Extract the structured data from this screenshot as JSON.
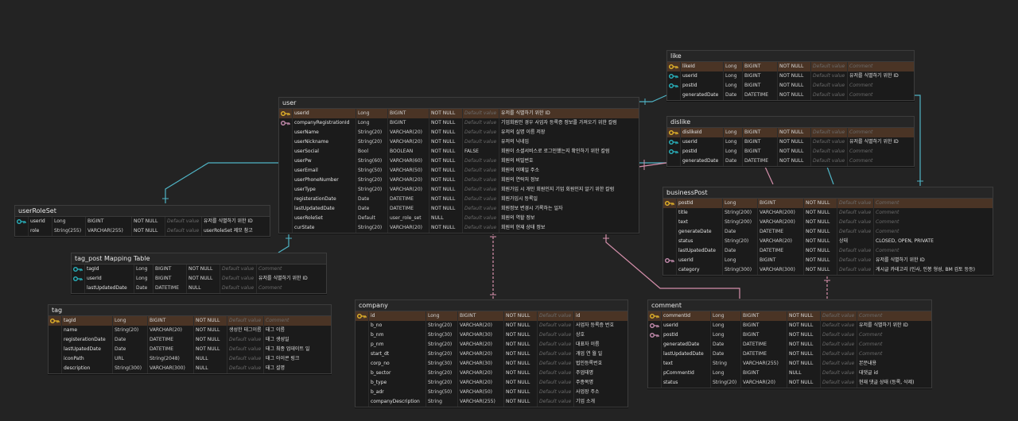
{
  "colors": {
    "background": "#232323",
    "pk_row": "#4a3425",
    "key_gold": "#e5b52a",
    "key_teal": "#29b6c1",
    "key_pink": "#c98fb2",
    "wire_teal": "#4fb3c4",
    "wire_pink": "#d58fab"
  },
  "tables": [
    {
      "id": "user",
      "title": "user",
      "rows": [
        {
          "key": "pk",
          "name": "userId",
          "type": "Long",
          "db": "BIGINT",
          "null": "NOT NULL",
          "default": "Default value",
          "comment": "유저를 식별하기 위한 ID"
        },
        {
          "key": "fk-pink",
          "name": "companyRegistrationId",
          "type": "Long",
          "db": "BIGINT",
          "null": "NOT NULL",
          "default": "Default value",
          "comment": "기업회원인 경우 사업자 등록증 정보를 가져오기 위한 칼럼"
        },
        {
          "key": "",
          "name": "userName",
          "type": "String(20)",
          "db": "VARCHAR(20)",
          "null": "NOT NULL",
          "default": "Default value",
          "comment": "유저의 실명 이름 저장"
        },
        {
          "key": "",
          "name": "userNickname",
          "type": "String(20)",
          "db": "VARCHAR(20)",
          "null": "NOT NULL",
          "default": "Default value",
          "comment": "유저의 닉네임"
        },
        {
          "key": "",
          "name": "userSocial",
          "type": "Bool",
          "db": "BOOLEAN",
          "null": "NOT NULL",
          "default": "FALSE",
          "comment": "회원이 소셜서비스로 로그인했는지 확인하기 위한 칼럼"
        },
        {
          "key": "",
          "name": "userPw",
          "type": "String(60)",
          "db": "VARCHAR(60)",
          "null": "NOT NULL",
          "default": "Default value",
          "comment": "회원의 비밀번호"
        },
        {
          "key": "",
          "name": "userEmail",
          "type": "String(50)",
          "db": "VARCHAR(50)",
          "null": "NOT NULL",
          "default": "Default value",
          "comment": "회원의 이메일 주소"
        },
        {
          "key": "",
          "name": "userPhoneNumber",
          "type": "String(20)",
          "db": "VARCHAR(20)",
          "null": "NOT NULL",
          "default": "Default value",
          "comment": "회원의 연락처 정보"
        },
        {
          "key": "",
          "name": "userType",
          "type": "String(20)",
          "db": "VARCHAR(20)",
          "null": "NOT NULL",
          "default": "Default value",
          "comment": "회원가입 시 개인 회원인지 기업 회원인지 알기 위한 칼럼"
        },
        {
          "key": "",
          "name": "registerationDate",
          "type": "Date",
          "db": "DATETIME",
          "null": "NOT NULL",
          "default": "Default value",
          "comment": "회원가입시 등록일"
        },
        {
          "key": "",
          "name": "lastUpdatedDate",
          "type": "Date",
          "db": "DATETIME",
          "null": "NOT NULL",
          "default": "Default value",
          "comment": "회원정보 변경시 기록하는 일자"
        },
        {
          "key": "",
          "name": "userRoleSet",
          "type": "Default",
          "db": "user_role_set",
          "null": "NULL",
          "default": "Default value",
          "comment": "회원의 역할 정보"
        },
        {
          "key": "",
          "name": "curState",
          "type": "String(20)",
          "db": "VARCHAR(20)",
          "null": "NOT NULL",
          "default": "Default value",
          "comment": "회원의 현재 상태 정보"
        }
      ]
    },
    {
      "id": "like",
      "title": "like",
      "rows": [
        {
          "key": "pk",
          "name": "likeId",
          "type": "Long",
          "db": "BIGINT",
          "null": "NOT NULL",
          "default": "Default value",
          "comment": "Comment"
        },
        {
          "key": "fk-teal",
          "name": "userId",
          "type": "Long",
          "db": "BIGINT",
          "null": "NOT NULL",
          "default": "Default value",
          "comment": "유저를 식별하기 위한 ID"
        },
        {
          "key": "fk-teal",
          "name": "postId",
          "type": "Long",
          "db": "BIGINT",
          "null": "NOT NULL",
          "default": "Default value",
          "comment": "Comment"
        },
        {
          "key": "",
          "name": "generatedDate",
          "type": "Date",
          "db": "DATETIME",
          "null": "NOT NULL",
          "default": "Default value",
          "comment": "Comment"
        }
      ]
    },
    {
      "id": "dislike",
      "title": "dislike",
      "rows": [
        {
          "key": "pk",
          "name": "dislikeId",
          "type": "Long",
          "db": "BIGINT",
          "null": "NOT NULL",
          "default": "Default value",
          "comment": "Comment"
        },
        {
          "key": "fk-teal",
          "name": "userId",
          "type": "Long",
          "db": "BIGINT",
          "null": "NOT NULL",
          "default": "Default value",
          "comment": "유저를 식별하기 위한 ID"
        },
        {
          "key": "fk-teal",
          "name": "postId",
          "type": "Long",
          "db": "BIGINT",
          "null": "NOT NULL",
          "default": "Default value",
          "comment": "Comment"
        },
        {
          "key": "",
          "name": "generatedDate",
          "type": "Date",
          "db": "DATETIME",
          "null": "NOT NULL",
          "default": "Default value",
          "comment": "Comment"
        }
      ]
    },
    {
      "id": "businessPost",
      "title": "businessPost",
      "rows": [
        {
          "key": "pk",
          "name": "postId",
          "type": "Long",
          "db": "BIGINT",
          "null": "NOT NULL",
          "default": "Default value",
          "comment": "Comment"
        },
        {
          "key": "",
          "name": "title",
          "type": "String(200)",
          "db": "VARCHAR(200)",
          "null": "NOT NULL",
          "default": "Default value",
          "comment": "Comment"
        },
        {
          "key": "",
          "name": "text",
          "type": "String(200)",
          "db": "VARCHAR(200)",
          "null": "NOT NULL",
          "default": "Default value",
          "comment": "Comment"
        },
        {
          "key": "",
          "name": "generateDate",
          "type": "Date",
          "db": "DATETIME",
          "null": "NOT NULL",
          "default": "Default value",
          "comment": "Comment"
        },
        {
          "key": "",
          "name": "status",
          "type": "String(20)",
          "db": "VARCHAR(20)",
          "null": "NOT NULL",
          "default": "상태",
          "comment": "CLOSED, OPEN, PRIVATE"
        },
        {
          "key": "",
          "name": "lastUpatedDate",
          "type": "Date",
          "db": "DATETIME",
          "null": "NOT NULL",
          "default": "Default value",
          "comment": "Comment"
        },
        {
          "key": "fk-pink",
          "name": "userId",
          "type": "Long",
          "db": "BIGINT",
          "null": "NOT NULL",
          "default": "Default value",
          "comment": "유저를 식별하기 위한 ID"
        },
        {
          "key": "",
          "name": "category",
          "type": "String(300)",
          "db": "VARCHAR(300)",
          "null": "NOT NULL",
          "default": "Default value",
          "comment": "게시글 카테고리 (인사, 인봉 형성, BM 검토 등등)"
        }
      ]
    },
    {
      "id": "userRoleSet",
      "title": "userRoleSet",
      "rows": [
        {
          "key": "fk-teal",
          "name": "userId",
          "type": "Long",
          "db": "BIGINT",
          "null": "NOT NULL",
          "default": "Default value",
          "comment": "유저를 식별하기 위한 ID"
        },
        {
          "key": "",
          "name": "role",
          "type": "String(255)",
          "db": "VARCHAR(255)",
          "null": "NOT NULL",
          "default": "Default value",
          "comment": "userRoleSet 제모 참고"
        }
      ]
    },
    {
      "id": "tagPost",
      "title": "tag_post Mapping Table",
      "rows": [
        {
          "key": "fk-teal",
          "name": "tagId",
          "type": "Long",
          "db": "BIGINT",
          "null": "NOT NULL",
          "default": "Default value",
          "comment": "Comment"
        },
        {
          "key": "fk-teal",
          "name": "userId",
          "type": "Long",
          "db": "BIGINT",
          "null": "NOT NULL",
          "default": "Default value",
          "comment": "유저를 식별하기 위한 ID"
        },
        {
          "key": "",
          "name": "lastUpdatedDate",
          "type": "Date",
          "db": "DATETIME",
          "null": "NULL",
          "default": "Default value",
          "comment": "Comment"
        }
      ]
    },
    {
      "id": "tag",
      "title": "tag",
      "rows": [
        {
          "key": "pk",
          "name": "tagId",
          "type": "Long",
          "db": "BIGINT",
          "null": "NOT NULL",
          "default": "Default value",
          "comment": "Comment"
        },
        {
          "key": "",
          "name": "name",
          "type": "String(20)",
          "db": "VARCHAR(20)",
          "null": "NOT NULL",
          "default": "생성한 태그이름",
          "comment": "태그 이름"
        },
        {
          "key": "",
          "name": "registerationDate",
          "type": "Date",
          "db": "DATETIME",
          "null": "NOT NULL",
          "default": "Default value",
          "comment": "태그 생성일"
        },
        {
          "key": "",
          "name": "lastUpatedDate",
          "type": "Date",
          "db": "DATETIME",
          "null": "NOT NULL",
          "default": "Default value",
          "comment": "태그 최종 업데이트 일"
        },
        {
          "key": "",
          "name": "iconPath",
          "type": "URL",
          "db": "String(2048)",
          "null": "NULL",
          "default": "Default value",
          "comment": "태그 아이콘 링크"
        },
        {
          "key": "",
          "name": "description",
          "type": "String(300)",
          "db": "VARCHAR(300)",
          "null": "NULL",
          "default": "Default value",
          "comment": "태그 설명"
        }
      ]
    },
    {
      "id": "company",
      "title": "company",
      "rows": [
        {
          "key": "pk",
          "name": "id",
          "type": "Long",
          "db": "BIGINT",
          "null": "NOT NULL",
          "default": "Default value",
          "comment": "id"
        },
        {
          "key": "",
          "name": "b_no",
          "type": "String(20)",
          "db": "VARCHAR(20)",
          "null": "NOT NULL",
          "default": "Default value",
          "comment": "사업자 등록증 번호"
        },
        {
          "key": "",
          "name": "b_nm",
          "type": "String(30)",
          "db": "VARCHAR(30)",
          "null": "NOT NULL",
          "default": "Default value",
          "comment": "상호"
        },
        {
          "key": "",
          "name": "p_nm",
          "type": "String(20)",
          "db": "VARCHAR(20)",
          "null": "NOT NULL",
          "default": "Default value",
          "comment": "대표자 이름"
        },
        {
          "key": "",
          "name": "start_dt",
          "type": "String(20)",
          "db": "VARCHAR(20)",
          "null": "NOT NULL",
          "default": "Default value",
          "comment": "개업 연 월 일"
        },
        {
          "key": "",
          "name": "corp_no",
          "type": "String(30)",
          "db": "VARCHAR(30)",
          "null": "NOT NULL",
          "default": "Default value",
          "comment": "법인등록번호"
        },
        {
          "key": "",
          "name": "b_sector",
          "type": "String(20)",
          "db": "VARCHAR(20)",
          "null": "NOT NULL",
          "default": "Default value",
          "comment": "주업태명"
        },
        {
          "key": "",
          "name": "b_type",
          "type": "String(20)",
          "db": "VARCHAR(20)",
          "null": "NOT NULL",
          "default": "Default value",
          "comment": "주종목명"
        },
        {
          "key": "",
          "name": "b_adr",
          "type": "String(50)",
          "db": "VARCHAR(50)",
          "null": "NOT NULL",
          "default": "Default value",
          "comment": "사업장 주소"
        },
        {
          "key": "",
          "name": "companyDescription",
          "type": "String",
          "db": "VARCHAR(255)",
          "null": "NOT NULL",
          "default": "Default value",
          "comment": "기업 소개"
        }
      ]
    },
    {
      "id": "comment",
      "title": "comment",
      "rows": [
        {
          "key": "pk",
          "name": "commentId",
          "type": "Long",
          "db": "BIGINT",
          "null": "NOT NULL",
          "default": "Default value",
          "comment": "Comment"
        },
        {
          "key": "fk-pink",
          "name": "userId",
          "type": "Long",
          "db": "BIGINT",
          "null": "NOT NULL",
          "default": "Default value",
          "comment": "유저를 식별하기 위한 ID"
        },
        {
          "key": "fk-pink",
          "name": "postId",
          "type": "Long",
          "db": "BIGINT",
          "null": "NOT NULL",
          "default": "Default value",
          "comment": "Comment"
        },
        {
          "key": "",
          "name": "generatedDate",
          "type": "Date",
          "db": "DATETIME",
          "null": "NOT NULL",
          "default": "Default value",
          "comment": "Comment"
        },
        {
          "key": "",
          "name": "lastUpdatedDate",
          "type": "Date",
          "db": "DATETIME",
          "null": "NOT NULL",
          "default": "Default value",
          "comment": "Comment"
        },
        {
          "key": "",
          "name": "text",
          "type": "String",
          "db": "VARCHAR(255)",
          "null": "NOT NULL",
          "default": "Default value",
          "comment": "본문내용"
        },
        {
          "key": "",
          "name": "pCommentId",
          "type": "Long",
          "db": "BIGINT",
          "null": "NULL",
          "default": "Default value",
          "comment": "대댓글 id"
        },
        {
          "key": "",
          "name": "status",
          "type": "String(20)",
          "db": "VARCHAR(20)",
          "null": "NOT NULL",
          "default": "Default value",
          "comment": "현재 댓글 상태 (등록, 삭제)"
        }
      ]
    }
  ]
}
